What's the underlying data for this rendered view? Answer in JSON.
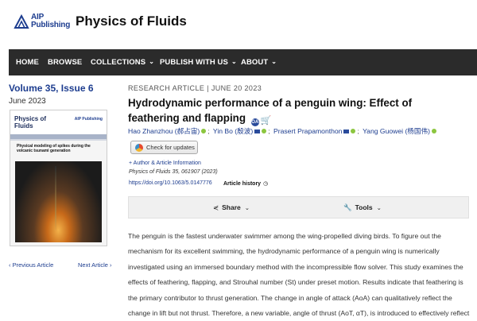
{
  "header": {
    "publisher_line1": "AIP",
    "publisher_line2": "Publishing",
    "journal": "Physics of Fluids"
  },
  "nav": {
    "items": [
      {
        "label": "HOME",
        "dropdown": false
      },
      {
        "label": "BROWSE",
        "dropdown": false
      },
      {
        "label": "COLLECTIONS",
        "dropdown": true
      },
      {
        "label": "PUBLISH WITH US",
        "dropdown": true
      },
      {
        "label": "ABOUT",
        "dropdown": true
      }
    ]
  },
  "issue": {
    "volume": "Volume 35, Issue 6",
    "date": "June 2023",
    "cover": {
      "title": "Physics of Fluids",
      "publisher": "AIP Publishing",
      "caption": "Physical modeling of spikes during the volcanic tsunami generation"
    },
    "prev_label": "‹ Previous Article",
    "next_label": "Next Article ›"
  },
  "article": {
    "type": "RESEARCH ARTICLE",
    "date": "JUNE 20 2023",
    "title": "Hydrodynamic performance of a penguin wing: Effect of feathering and flapping",
    "authors": [
      {
        "name": "Hao Zhanzhou (郝占宙)",
        "mail": false,
        "orcid": true
      },
      {
        "name": "Yin Bo (殷波)",
        "mail": true,
        "orcid": true
      },
      {
        "name": "Prasert Prapamonthon",
        "mail": true,
        "orcid": true
      },
      {
        "name": "Yang Guowei (杨国伟)",
        "mail": false,
        "orcid": true
      }
    ],
    "check_updates": "Check for updates",
    "affiliation_link": "+ Author & Article Information",
    "citation": "Physics of Fluids 35, 061907 (2023)",
    "doi": "https://doi.org/10.1063/5.0147776",
    "history": "Article history",
    "share": "Share",
    "tools": "Tools",
    "abstract": "The penguin is the fastest underwater swimmer among the wing-propelled diving birds. To figure out the mechanism for its excellent swimming, the hydrodynamic performance of a penguin wing is numerically investigated using an immersed boundary method with the incompressible flow solver. This study examines the effects of feathering, flapping, and Strouhal number (St) under preset motion. Results indicate that feathering is the primary contributor to thrust generation. The change in angle of attack (AoA) can qualitatively reflect the change in lift but not thrust. Therefore, a new variable, angle of thrust (AoT, αT), is introduced to effectively reflect the change of thrust across"
  },
  "colors": {
    "nav_bg": "#2b2b2b",
    "link": "#1d3d8f",
    "orcid": "#8cc63f"
  }
}
